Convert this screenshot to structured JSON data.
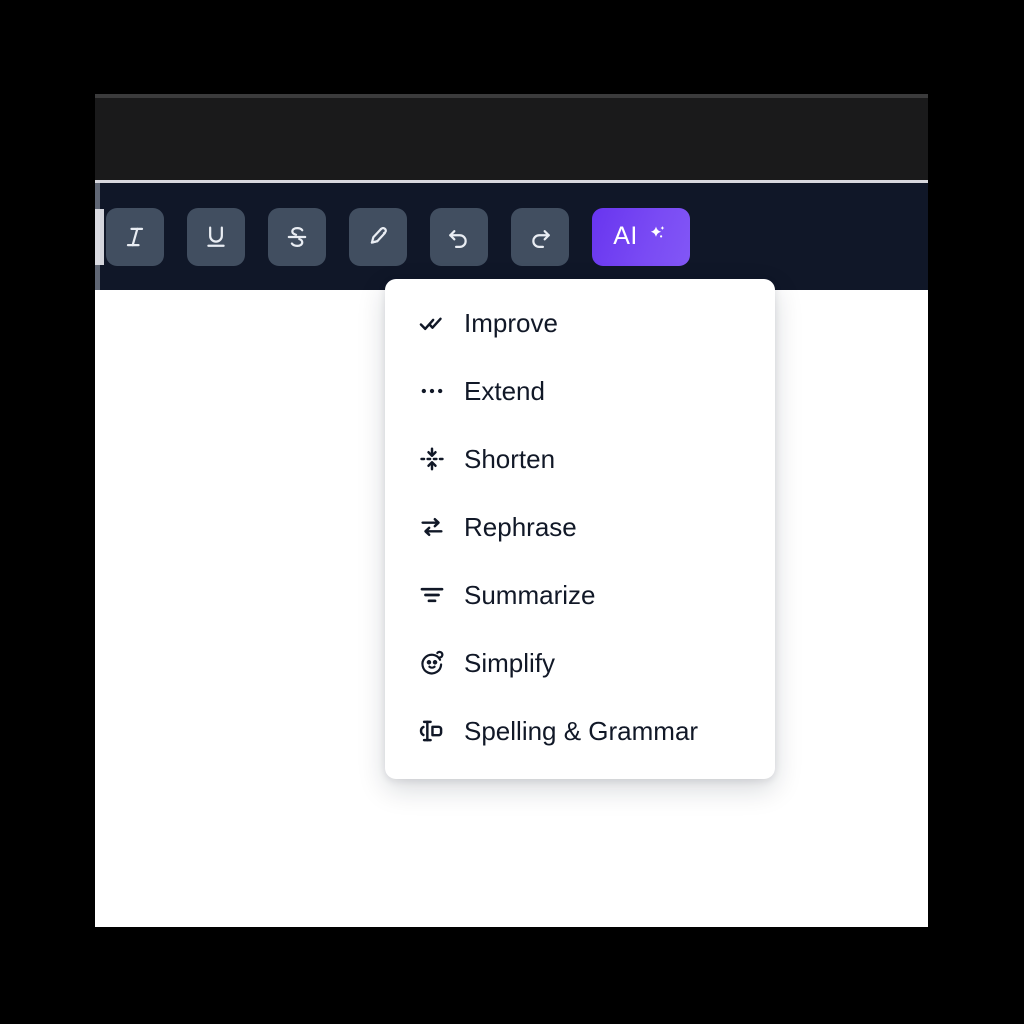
{
  "window": {
    "background_color": "#ffffff",
    "top_bar_color": "#1a1a1b",
    "toolbar_color": "#101728"
  },
  "toolbar": {
    "button_color": "#414e60",
    "ai_accent_color": "#7a4bf4",
    "buttons": [
      {
        "name": "italic",
        "icon": "italic-icon",
        "label": "Italic"
      },
      {
        "name": "underline",
        "icon": "underline-icon",
        "label": "Underline"
      },
      {
        "name": "strikethrough",
        "icon": "strikethrough-icon",
        "label": "Strikethrough"
      },
      {
        "name": "highlight",
        "icon": "highlighter-icon",
        "label": "Highlight"
      },
      {
        "name": "undo",
        "icon": "undo-icon",
        "label": "Undo"
      },
      {
        "name": "redo",
        "icon": "redo-icon",
        "label": "Redo"
      }
    ],
    "ai_button": {
      "label": "AI",
      "icon": "sparkle-icon"
    }
  },
  "ai_menu": {
    "open": true,
    "text_color": "#111827",
    "background_color": "#ffffff",
    "items": [
      {
        "label": "Improve",
        "icon": "double-check-icon"
      },
      {
        "label": "Extend",
        "icon": "ellipsis-icon"
      },
      {
        "label": "Shorten",
        "icon": "arrows-collapse-icon"
      },
      {
        "label": "Rephrase",
        "icon": "swap-arrows-icon"
      },
      {
        "label": "Summarize",
        "icon": "decreasing-bars-icon"
      },
      {
        "label": "Simplify",
        "icon": "baby-face-icon"
      },
      {
        "label": "Spelling & Grammar",
        "icon": "text-cursor-icon"
      }
    ]
  }
}
